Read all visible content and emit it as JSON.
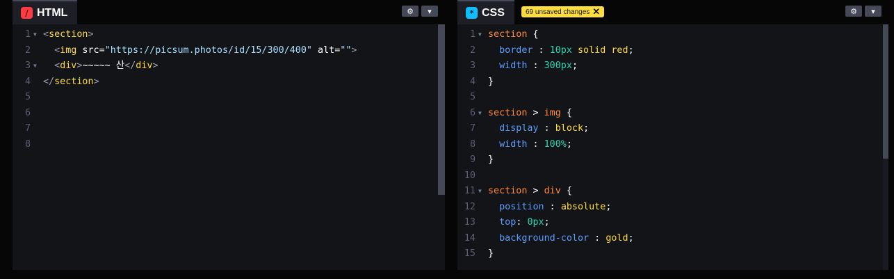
{
  "html_panel": {
    "title": "HTML",
    "icon": "slash",
    "settings_icon": "gear",
    "collapse_icon": "chevron-down",
    "lines": [
      {
        "n": "1",
        "fold": true,
        "tokens": [
          [
            "bracket",
            "<"
          ],
          [
            "tag",
            "section"
          ],
          [
            "bracket",
            ">"
          ]
        ]
      },
      {
        "n": "2",
        "fold": false,
        "tokens": [
          [
            "text",
            "  "
          ],
          [
            "bracket",
            "<"
          ],
          [
            "tag",
            "img"
          ],
          [
            "attr",
            " src="
          ],
          [
            "str",
            "\"https://picsum.photos/id/15/300/400\""
          ],
          [
            "attr",
            " alt="
          ],
          [
            "str",
            "\"\""
          ],
          [
            "bracket",
            ">"
          ]
        ]
      },
      {
        "n": "3",
        "fold": true,
        "tokens": [
          [
            "text",
            "  "
          ],
          [
            "bracket",
            "<"
          ],
          [
            "tag",
            "div"
          ],
          [
            "bracket",
            ">"
          ],
          [
            "text",
            "~~~~~ 산"
          ],
          [
            "bracket",
            "</"
          ],
          [
            "tag",
            "div"
          ],
          [
            "bracket",
            ">"
          ]
        ]
      },
      {
        "n": "4",
        "fold": false,
        "tokens": [
          [
            "bracket",
            "</"
          ],
          [
            "tag",
            "section"
          ],
          [
            "bracket",
            ">"
          ]
        ]
      },
      {
        "n": "5",
        "fold": false,
        "tokens": []
      },
      {
        "n": "6",
        "fold": false,
        "tokens": []
      },
      {
        "n": "7",
        "fold": false,
        "tokens": []
      },
      {
        "n": "8",
        "fold": false,
        "tokens": []
      }
    ]
  },
  "css_panel": {
    "title": "CSS",
    "icon": "asterisk",
    "badge": "69 unsaved changes",
    "badge_close": "✕",
    "settings_icon": "gear",
    "collapse_icon": "chevron-down",
    "lines": [
      {
        "n": "1",
        "fold": true,
        "tokens": [
          [
            "sel",
            "section"
          ],
          [
            "punc",
            " {"
          ]
        ]
      },
      {
        "n": "2",
        "fold": false,
        "tokens": [
          [
            "text",
            "  "
          ],
          [
            "prop",
            "border"
          ],
          [
            "punc",
            " : "
          ],
          [
            "num",
            "10px"
          ],
          [
            "val",
            " solid"
          ],
          [
            "val",
            " red"
          ],
          [
            "punc",
            ";"
          ]
        ]
      },
      {
        "n": "3",
        "fold": false,
        "tokens": [
          [
            "text",
            "  "
          ],
          [
            "prop",
            "width"
          ],
          [
            "punc",
            " : "
          ],
          [
            "num",
            "300px"
          ],
          [
            "punc",
            ";"
          ]
        ]
      },
      {
        "n": "4",
        "fold": false,
        "tokens": [
          [
            "punc",
            "}"
          ]
        ]
      },
      {
        "n": "5",
        "fold": false,
        "tokens": []
      },
      {
        "n": "6",
        "fold": true,
        "tokens": [
          [
            "sel",
            "section"
          ],
          [
            "punc",
            " > "
          ],
          [
            "sel",
            "img"
          ],
          [
            "punc",
            " {"
          ]
        ]
      },
      {
        "n": "7",
        "fold": false,
        "tokens": [
          [
            "text",
            "  "
          ],
          [
            "prop",
            "display"
          ],
          [
            "punc",
            " : "
          ],
          [
            "val",
            "block"
          ],
          [
            "punc",
            ";"
          ]
        ]
      },
      {
        "n": "8",
        "fold": false,
        "tokens": [
          [
            "text",
            "  "
          ],
          [
            "prop",
            "width"
          ],
          [
            "punc",
            " : "
          ],
          [
            "num",
            "100%"
          ],
          [
            "punc",
            ";"
          ]
        ]
      },
      {
        "n": "9",
        "fold": false,
        "tokens": [
          [
            "punc",
            "}"
          ]
        ]
      },
      {
        "n": "10",
        "fold": false,
        "tokens": []
      },
      {
        "n": "11",
        "fold": true,
        "tokens": [
          [
            "sel",
            "section"
          ],
          [
            "punc",
            " > "
          ],
          [
            "sel",
            "div"
          ],
          [
            "punc",
            " {"
          ]
        ]
      },
      {
        "n": "12",
        "fold": false,
        "tokens": [
          [
            "text",
            "  "
          ],
          [
            "prop",
            "position"
          ],
          [
            "punc",
            " : "
          ],
          [
            "val",
            "absolute"
          ],
          [
            "punc",
            ";"
          ]
        ]
      },
      {
        "n": "13",
        "fold": false,
        "tokens": [
          [
            "text",
            "  "
          ],
          [
            "prop",
            "top"
          ],
          [
            "punc",
            ": "
          ],
          [
            "num",
            "0px"
          ],
          [
            "punc",
            ";"
          ]
        ]
      },
      {
        "n": "14",
        "fold": false,
        "tokens": [
          [
            "text",
            "  "
          ],
          [
            "prop",
            "background-color"
          ],
          [
            "punc",
            " : "
          ],
          [
            "val",
            "gold"
          ],
          [
            "punc",
            ";"
          ]
        ]
      },
      {
        "n": "15",
        "fold": false,
        "tokens": [
          [
            "punc",
            "}"
          ]
        ]
      }
    ]
  },
  "colors": {
    "background": "#131417",
    "tag": "#ffdd40",
    "string": "#a8e0ff",
    "selector": "#ff8a3d",
    "property": "#5c9dff",
    "number": "#2bd6b4",
    "badge": "#ffdd40"
  }
}
